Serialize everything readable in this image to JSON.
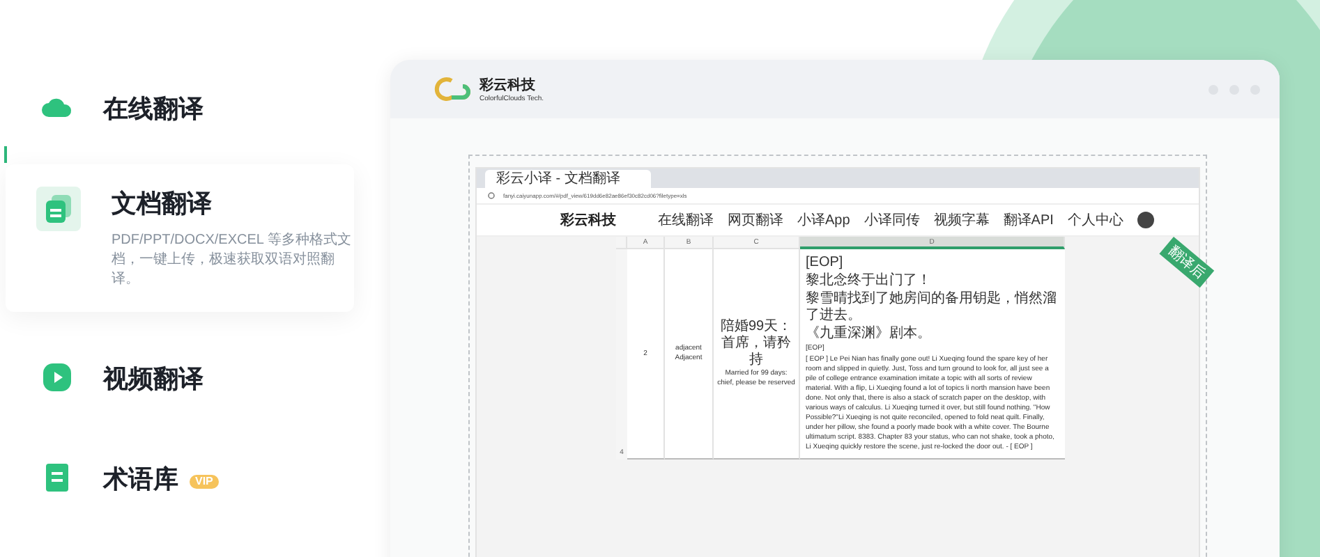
{
  "sidebar": {
    "items": [
      {
        "kind": "cloud",
        "title": "在线翻译",
        "selected": false
      },
      {
        "kind": "document",
        "title": "文档翻译",
        "description": "PDF/PPT/DOCX/EXCEL 等多种格式文档，一键上传，极速获取双语对照翻译。",
        "selected": true
      },
      {
        "kind": "video",
        "title": "视频翻译",
        "selected": false
      },
      {
        "kind": "glossary",
        "title": "术语库",
        "badge": "VIP",
        "selected": false
      }
    ]
  },
  "showcase": {
    "brand": {
      "name": "彩云科技",
      "tagline": "ColorfulClouds Tech."
    },
    "browser": {
      "tab_title": "彩云小译 - 文档翻译",
      "url": "fanyi.caiyunapp.com/#/pdf_view/619dd6e82ae86ef30c82cd06?filetype=xls",
      "site_brand": "彩云科技",
      "nav": [
        "在线翻译",
        "网页翻译",
        "小译App",
        "小译同传",
        "视频字幕",
        "翻译API",
        "个人中心"
      ]
    },
    "sheet": {
      "columns": [
        "A",
        "B",
        "C",
        "D"
      ],
      "corner_badge": "翻译后",
      "row_number": "4",
      "cell_a": "2",
      "cell_b": [
        "adjacent",
        "Adjacent"
      ],
      "cell_c": [
        "陪婚99天：首席，请矜持",
        "Married for 99 days: chief, please be reserved"
      ],
      "cell_d_source": [
        "[EOP]",
        "黎北念终于出门了！",
        "黎雪晴找到了她房间的备用钥匙，悄然溜了进去。",
        "《九重深渊》剧本。"
      ],
      "cell_d_translation": [
        "[EOP]",
        "[ EOP ] Le Pei Nian has finally gone out! Li Xueqing found the spare key of her room and slipped in quietly. Just, Toss and turn ground to look for, all just see a pile of college entrance examination imitate a topic with all sorts of review material. With a flip, Li Xueqing found a lot of topics li north mansion have been done. Not only that, there is also a stack of scratch paper on the desktop, with various ways of calculus. Li Xueqing turned it over, but still found nothing. \"How Possible?\"Li Xueqing is not quite reconciled, opened to fold neat quilt. Finally, under her pillow, she found a poorly made book with a white cover. The Bourne ultimatum script. 8383. Chapter 83 your status, who can not shake, took a photo, Li Xueqing quickly restore the scene, just re-locked the door out. - [ EOP ]"
      ]
    }
  }
}
